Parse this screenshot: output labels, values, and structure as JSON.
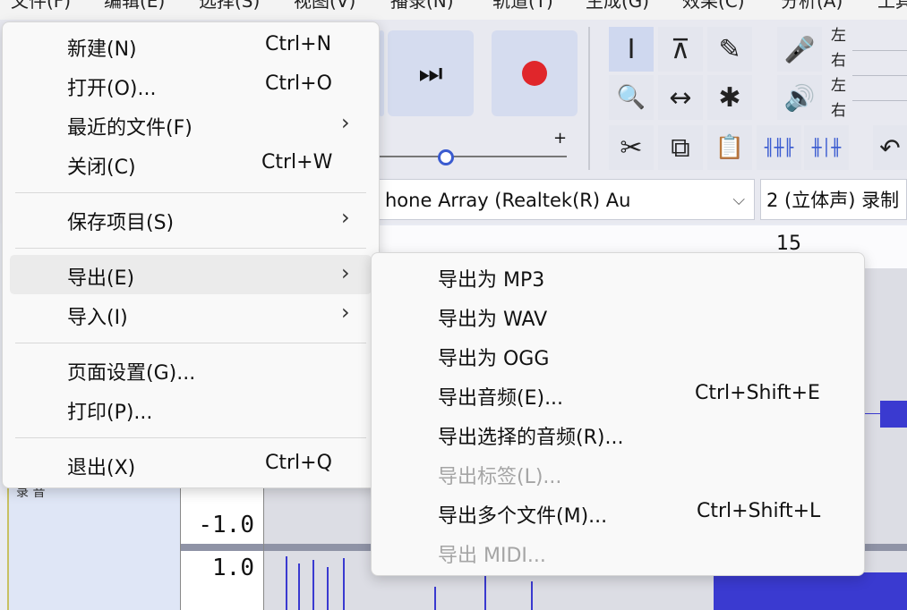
{
  "menubar": {
    "items": [
      "文件(F)",
      "编辑(E)",
      "选择(S)",
      "视图(V)",
      "播录(N)",
      "轨道(T)",
      "生成(G)",
      "效果(C)",
      "分析(A)",
      "工具"
    ]
  },
  "toolbar": {
    "skip_end_icon": "⏭",
    "record_icon": "●",
    "record_color": "#e0262b",
    "tools": [
      "I",
      "⊼",
      "✎",
      "🔍",
      "↔",
      "✱",
      "✂",
      "⧉",
      "📋"
    ],
    "left_label": "左",
    "right_label": "右",
    "slider_plus": "+"
  },
  "device": {
    "input_device": "hone Array (Realtek(R) Au",
    "channels": "2 (立体声) 录制"
  },
  "ruler": {
    "tick": "15"
  },
  "track": {
    "name_fragment": "录 音",
    "scale_top": "1.0",
    "scale_bottom": "-1.0"
  },
  "file_menu": {
    "items": [
      {
        "label": "新建(N)",
        "shortcut": "Ctrl+N"
      },
      {
        "label": "打开(O)...",
        "shortcut": "Ctrl+O"
      },
      {
        "label": "最近的文件(F)",
        "shortcut": ""
      },
      {
        "label": "关闭(C)",
        "shortcut": "Ctrl+W"
      },
      {
        "label": "保存项目(S)",
        "shortcut": ""
      },
      {
        "label": "导出(E)",
        "shortcut": ""
      },
      {
        "label": "导入(I)",
        "shortcut": ""
      },
      {
        "label": "页面设置(G)...",
        "shortcut": ""
      },
      {
        "label": "打印(P)...",
        "shortcut": ""
      },
      {
        "label": "退出(X)",
        "shortcut": "Ctrl+Q"
      }
    ],
    "submenu_arrow": "›"
  },
  "export_menu": {
    "items": [
      {
        "label": "导出为 MP3",
        "shortcut": ""
      },
      {
        "label": "导出为 WAV",
        "shortcut": ""
      },
      {
        "label": "导出为 OGG",
        "shortcut": ""
      },
      {
        "label": "导出音频(E)...",
        "shortcut": "Ctrl+Shift+E"
      },
      {
        "label": "导出选择的音频(R)...",
        "shortcut": ""
      },
      {
        "label": "导出标签(L)...",
        "shortcut": "",
        "disabled": true
      },
      {
        "label": "导出多个文件(M)...",
        "shortcut": "Ctrl+Shift+L"
      },
      {
        "label": "导出 MIDI...",
        "shortcut": "",
        "disabled": true
      }
    ]
  }
}
